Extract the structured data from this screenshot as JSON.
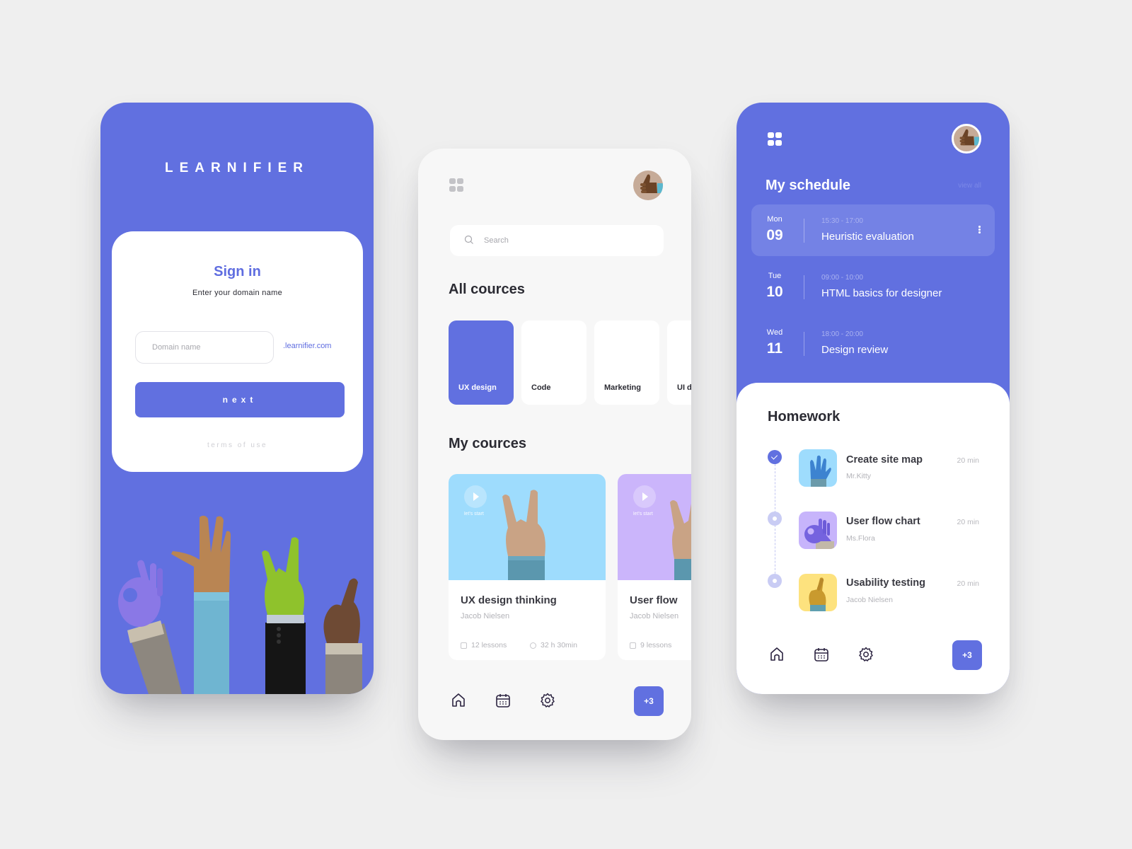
{
  "colors": {
    "accent": "#6170e0",
    "background": "#efefef",
    "course_blue": "#9edcfd",
    "course_purple": "#cbb5fb",
    "thumb_blue": "#9edcfd",
    "thumb_purple": "#c7b4fb",
    "thumb_yellow": "#fde27e"
  },
  "signin_screen": {
    "brand": "LEARNIFIER",
    "title": "Sign in",
    "subtitle": "Enter your domain name",
    "domain_input": {
      "placeholder": "Domain name",
      "value": ""
    },
    "domain_suffix": ".learnifier.com",
    "next_label": "next",
    "terms_label": "terms of use"
  },
  "courses_screen": {
    "menu_icon": "grid-icon",
    "avatar_icon": "thumbs-up-avatar",
    "search": {
      "placeholder": "Search",
      "value": "",
      "icon": "search-icon"
    },
    "all_courses_title": "All cources",
    "categories": [
      {
        "label": "UX design",
        "active": true
      },
      {
        "label": "Code",
        "active": false
      },
      {
        "label": "Marketing",
        "active": false
      },
      {
        "label": "UI design",
        "active": false
      }
    ],
    "my_courses_title": "My cources",
    "courses": [
      {
        "title": "UX design thinking",
        "author": "Jacob Nielsen",
        "lessons": "12 lessons",
        "duration": "32 h 30min",
        "cta": "let's start"
      },
      {
        "title": "User flow",
        "author": "Jacob Nielsen",
        "lessons": "9 lessons",
        "duration": "",
        "cta": "let's start"
      }
    ],
    "nav": {
      "items": [
        "home-icon",
        "calendar-icon",
        "settings-icon"
      ],
      "badge": "+3"
    }
  },
  "schedule_screen": {
    "menu_icon": "grid-icon",
    "avatar_icon": "thumbs-up-avatar",
    "title": "My schedule",
    "view_all": "view all",
    "items": [
      {
        "day": "Mon",
        "date": "09",
        "time": "15:30 - 17:00",
        "name": "Heuristic evaluation",
        "active": true
      },
      {
        "day": "Tue",
        "date": "10",
        "time": "09:00 - 10:00",
        "name": "HTML basics for designer",
        "active": false
      },
      {
        "day": "Wed",
        "date": "11",
        "time": "18:00 - 20:00",
        "name": "Design review",
        "active": false
      }
    ],
    "homework_title": "Homework",
    "homework": [
      {
        "name": "Create site map",
        "teacher": "Mr.Kitty",
        "duration": "20 min",
        "done": true
      },
      {
        "name": "User flow chart",
        "teacher": "Ms.Flora",
        "duration": "20 min",
        "done": false
      },
      {
        "name": "Usability testing",
        "teacher": "Jacob Nielsen",
        "duration": "20 min",
        "done": false
      }
    ],
    "nav": {
      "items": [
        "home-icon",
        "calendar-icon",
        "settings-icon"
      ],
      "badge": "+3"
    }
  }
}
